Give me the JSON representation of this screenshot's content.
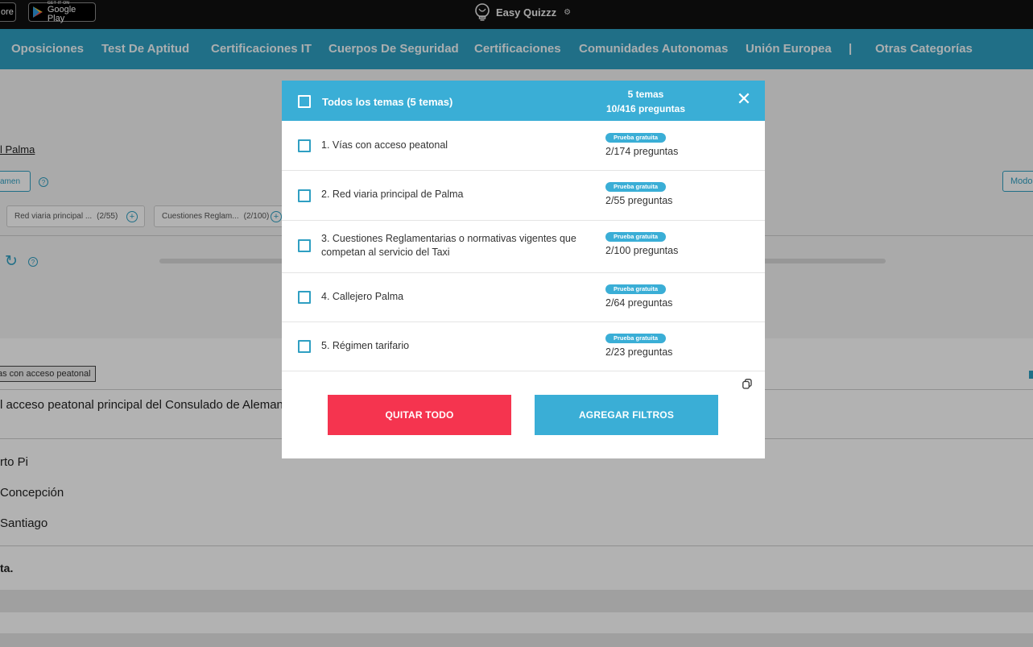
{
  "topbar": {
    "appstore_label": "ore",
    "gplay_small": "GET IT ON",
    "gplay_label": "Google Play",
    "brand_name": "Easy Quizzz",
    "brand_gear": "⚙"
  },
  "nav": {
    "items": [
      "Oposiciones",
      "Test De Aptitud",
      "Certificaciones IT",
      "Cuerpos De Seguridad",
      "Certificaciones",
      "Comunidades Autonomas",
      "Unión Europea",
      "|",
      "Otras Categorías"
    ]
  },
  "background": {
    "link": "l Palma",
    "examen_btn": "amen",
    "help": "?",
    "modo_btn": "Modo",
    "chips": [
      {
        "label": "Red viaria principal ...",
        "count": "(2/55)"
      },
      {
        "label": "Cuestiones Reglam...",
        "count": "(2/100)"
      }
    ],
    "reload": "↻",
    "topic_tag": "as con acceso peatonal",
    "question": "l acceso peatonal principal del Consulado de Aleman",
    "options": [
      "rto Pi",
      "Concepción",
      "Santiago"
    ],
    "answer_label": "ta."
  },
  "modal": {
    "header_title": "Todos los temas (5 temas)",
    "header_temas": "5 temas",
    "header_preguntas": "10/416 preguntas",
    "close": "✕",
    "rows": [
      {
        "title": "1. Vías con acceso peatonal",
        "badge": "Prueba gratuita",
        "count": "2/174 preguntas"
      },
      {
        "title": "2. Red viaria principal de Palma",
        "badge": "Prueba gratuita",
        "count": "2/55 preguntas"
      },
      {
        "title": "3. Cuestiones Reglamentarias o normativas vigentes que competan al servicio del Taxi",
        "badge": "Prueba gratuita",
        "count": "2/100 preguntas"
      },
      {
        "title": "4. Callejero Palma",
        "badge": "Prueba gratuita",
        "count": "2/64 preguntas"
      },
      {
        "title": "5. Régimen tarifario",
        "badge": "Prueba gratuita",
        "count": "2/23 preguntas"
      }
    ],
    "quitar_label": "QUITAR TODO",
    "agregar_label": "AGREGAR FILTROS"
  },
  "colors": {
    "nav": "#2f9fc2",
    "modal_header": "#3aaed6",
    "quitar": "#f5344f",
    "agregar": "#3aaed6"
  }
}
